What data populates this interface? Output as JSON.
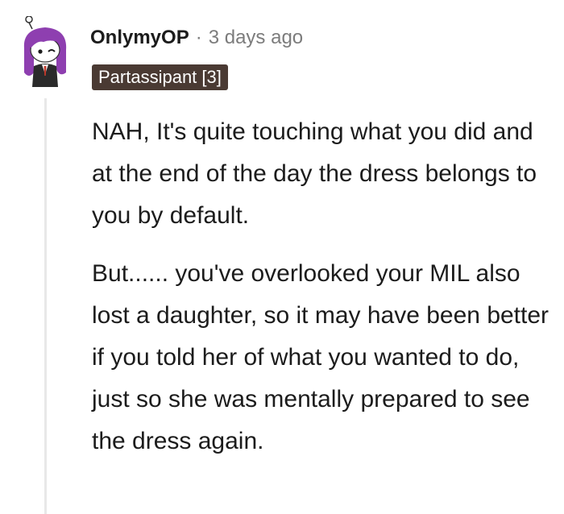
{
  "comment": {
    "username": "OnlymyOP",
    "separator": "·",
    "timestamp": "3 days ago",
    "flair": "Partassipant [3]",
    "paragraphs": [
      "NAH, It's quite touching what you did and at the end of the day the dress belongs to you by default.",
      "But...... you've overlooked your MIL also lost a daughter, so it may have been better if you told her of what you wanted to do, just so she was mentally prepared to see the dress again."
    ]
  },
  "colors": {
    "flair_bg": "#4a3a33",
    "meta_gray": "#7c7c7c",
    "avatar_hair": "#8e3fb0",
    "thread_line": "#e8e8e8"
  }
}
